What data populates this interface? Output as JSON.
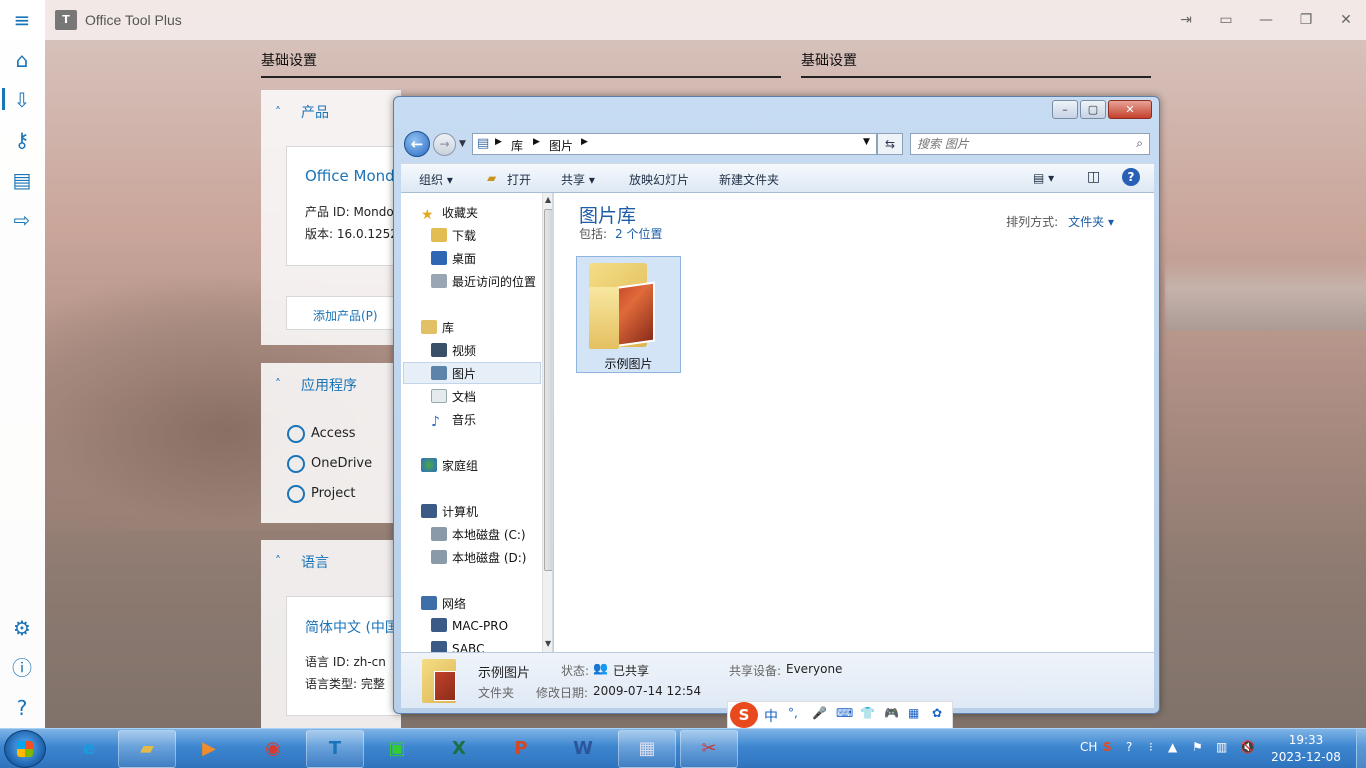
{
  "app": {
    "title": "Office Tool Plus",
    "logo_text": "T"
  },
  "titlebar_buttons": [
    "⇥",
    "▭",
    "—",
    "❐",
    "✕"
  ],
  "sidebar": {
    "top_icons": [
      "menu-icon",
      "home-icon",
      "deploy-icon",
      "key-icon",
      "toolbox-icon",
      "convert-icon"
    ],
    "bottom_icons": [
      "settings-icon",
      "info-icon",
      "help-icon"
    ]
  },
  "main": {
    "section_left": "基础设置",
    "section_right": "基础设置",
    "products": {
      "header": "产品",
      "product_name": "Office Mondo",
      "product_id": "产品 ID: Mondo",
      "version": "版本: 16.0.1252",
      "add_button": "添加产品(P)"
    },
    "apps": {
      "header": "应用程序",
      "items": [
        "Access",
        "OneDrive",
        "Project"
      ]
    },
    "language": {
      "header": "语言",
      "name": "简体中文 (中国",
      "lang_id": "语言 ID: zh-cn",
      "lang_type": "语言类型: 完整"
    }
  },
  "explorer": {
    "address": {
      "parts": [
        "库",
        "图片"
      ]
    },
    "search_placeholder": "搜索 图片",
    "toolbar": {
      "organize": "组织 ▾",
      "open": "打开",
      "share": "共享 ▾",
      "slideshow": "放映幻灯片",
      "new_folder": "新建文件夹",
      "help": "?"
    },
    "nav": {
      "favorites": "收藏夹",
      "downloads": "下载",
      "desktop": "桌面",
      "recent": "最近访问的位置",
      "libraries": "库",
      "videos": "视频",
      "pictures": "图片",
      "documents": "文档",
      "music": "音乐",
      "homegroup": "家庭组",
      "computer": "计算机",
      "disk_c": "本地磁盘 (C:)",
      "disk_d": "本地磁盘 (D:)",
      "network": "网络",
      "mac_pro": "MAC-PRO",
      "sabc": "SABC"
    },
    "content": {
      "title": "图片库",
      "includes_label": "包括:",
      "includes_link": "2 个位置",
      "arrange_label": "排列方式:",
      "arrange_value": "文件夹 ▾",
      "items": [
        {
          "label": "示例图片"
        }
      ]
    },
    "details": {
      "name": "示例图片",
      "type": "文件夹",
      "state_label": "状态:",
      "state_value": "已共享",
      "date_label": "修改日期:",
      "date_value": "2009-07-14 12:54",
      "shared_label": "共享设备:",
      "shared_value": "Everyone"
    }
  },
  "ime": {
    "items": [
      "S",
      "中",
      "°,",
      "🎤",
      "⌨",
      "👕",
      "🎮",
      "▦",
      "✿"
    ]
  },
  "taskbar": {
    "lang": "CH",
    "clock_time": "19:33",
    "clock_date": "2023-12-08"
  }
}
